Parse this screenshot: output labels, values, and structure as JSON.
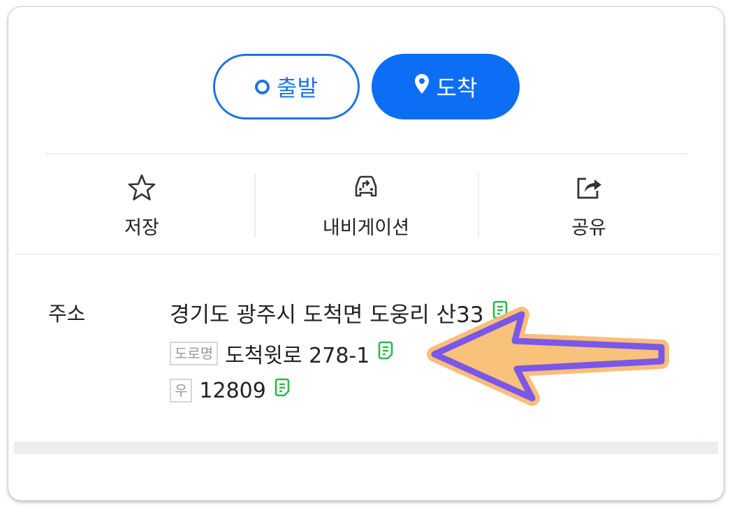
{
  "route_buttons": {
    "start_label": "출발",
    "arrive_label": "도착"
  },
  "actions": [
    {
      "label": "저장",
      "icon": "star-icon"
    },
    {
      "label": "내비게이션",
      "icon": "car-navigation-icon"
    },
    {
      "label": "공유",
      "icon": "share-icon"
    }
  ],
  "address": {
    "label": "주소",
    "jibun": "경기도 광주시 도척면 도웅리 산33",
    "road_tag": "도로명",
    "road": "도척윗로 278-1",
    "zip_tag": "우",
    "zip": "12809"
  },
  "colors": {
    "primary_blue": "#0b6ef5",
    "copy_green": "#2bb84a",
    "arrow_purple": "#7b57e8",
    "arrow_glow": "#f8b86a"
  }
}
